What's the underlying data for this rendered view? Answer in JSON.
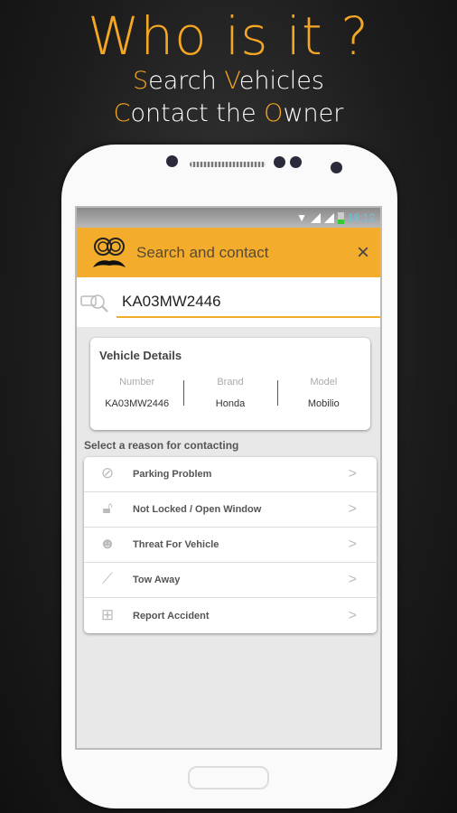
{
  "hero": {
    "title": "Who is it ?",
    "line1": {
      "first": "S",
      "rest1": "earch ",
      "second": "V",
      "rest2": "ehicles"
    },
    "line2": {
      "first": "C",
      "rest1": "ontact the ",
      "second": "O",
      "rest2": "wner"
    }
  },
  "status": {
    "time": "18:12"
  },
  "appbar": {
    "title": "Search and contact",
    "logo": "mustache-logo-icon",
    "close": "×"
  },
  "search": {
    "value": "KA03MW2446"
  },
  "vehicle": {
    "title": "Vehicle Details",
    "fields": [
      {
        "label": "Number",
        "value": "KA03MW2446"
      },
      {
        "label": "Brand",
        "value": "Honda"
      },
      {
        "label": "Model",
        "value": "Mobilio"
      }
    ]
  },
  "reason_label": "Select a reason for contacting",
  "reasons": [
    {
      "label": "Parking Problem",
      "icon": "no-parking-icon"
    },
    {
      "label": "Not Locked / Open Window",
      "icon": "unlocked-icon"
    },
    {
      "label": "Threat For Vehicle",
      "icon": "thief-icon"
    },
    {
      "label": "Tow Away",
      "icon": "tow-icon"
    },
    {
      "label": "Report Accident",
      "icon": "siren-icon"
    }
  ],
  "colors": {
    "accent": "#f5a623",
    "appbar": "#f4ac2d"
  }
}
